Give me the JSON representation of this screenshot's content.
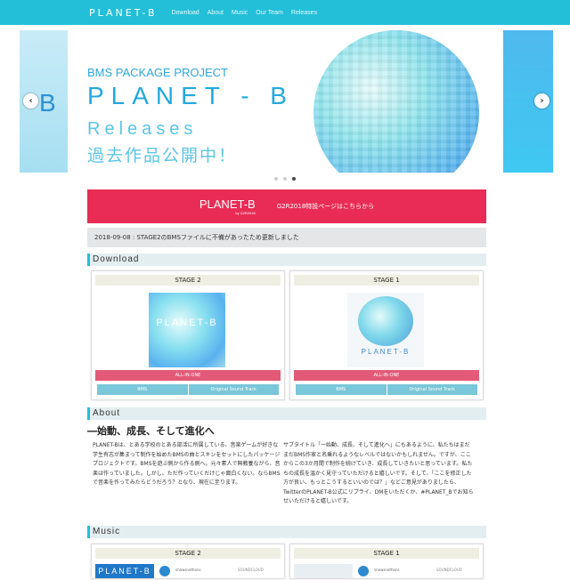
{
  "nav": {
    "brand": "PLANET-B",
    "links": [
      "Download",
      "About",
      "Music",
      "Our Team",
      "Releases"
    ]
  },
  "carousel": {
    "peek_left_letter": "B",
    "subtitle": "BMS PACKAGE PROJECT",
    "title": "PLANET - B",
    "releases": "Releases",
    "jp_caption": "過去作品公開中！",
    "prev": "‹",
    "next": "›",
    "dots": 3,
    "active_dot": 3
  },
  "banner": {
    "logo": "PLANET-B",
    "logo_sub": "by G2R2018",
    "text": "G2R2018特設ページはこちらから"
  },
  "news": "2018-09-08 : STAGE2のBMSファイルに不備があったため更新しました",
  "sections": {
    "download": "Download",
    "about": "About",
    "music": "Music"
  },
  "download_cards": [
    {
      "stage": "STAGE 2",
      "art_title": "PLANET-B",
      "all_in_one": "ALL-IN-ONE",
      "btn1": "BMS",
      "btn2": "Original Sound Track"
    },
    {
      "stage": "STAGE 1",
      "art_title": "PLANET-B",
      "all_in_one": "ALL-IN-ONE",
      "btn1": "BMS",
      "btn2": "Original Sound Track"
    }
  ],
  "about": {
    "title": "―始動、成長、そして進化へ",
    "left": "PLANET-Bは、とある学校のとある部活に所属している、音楽ゲームが好きな学生有志が集まって制作を始めたBMSの曲とスキンをセットにしたパッケージプロジェクトです。BMSを遊ぶ側から作る側へ。元々素人で無教養ながら、音楽は作っていました。しかし、ただ作っていくだけじゃ面白くない。ならBMSで音楽を作ってみたらどうだろう？となり、現在に至ります。",
    "right": "サブタイトル「一始動、成長、そして進化へ」にもあるように、私たちはまだまだBMS作家と名乗れるようなレベルではないかもしれません。ですが、ここからこの3か月間で制作を続けていき、成長していきたいと思っています。私たちの成長を温かく見守っていただけると嬉しいです。そして、「ここを修正した方が良い、もっとこうするといいのでは？」などご意見がありましたら、TwitterのPLANET-B公式にリプライ、DMをいただくか、#PLANET_Bでお知らせいただけると嬉しいです。"
  },
  "music_cards": [
    {
      "stage": "STAGE 2",
      "thumb": "PLANET-B",
      "user": "snowsnothons",
      "platform": "SOUNDCLOUD"
    },
    {
      "stage": "STAGE 1",
      "thumb": "",
      "user": "snowsnothons",
      "platform": "SOUNDCLOUD"
    }
  ],
  "colors": {
    "nav": "#23bfd8",
    "banner": "#e92c55",
    "all_in_one": "#e25a77",
    "sub_buttons": "#79c7d8"
  }
}
